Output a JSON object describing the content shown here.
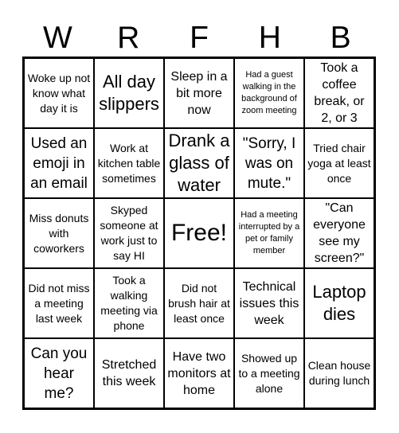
{
  "header": {
    "letters": [
      "W",
      "R",
      "F",
      "H",
      "B"
    ]
  },
  "board": {
    "rows": [
      [
        {
          "text": "Woke up not know what day it is",
          "size": "fs-s"
        },
        {
          "text": "All day slippers",
          "size": "fs-xl"
        },
        {
          "text": "Sleep in a bit more now",
          "size": "fs-m"
        },
        {
          "text": "Had a guest walking in the background of zoom meeting",
          "size": "fs-xs"
        },
        {
          "text": "Took a coffee break, or 2, or 3",
          "size": "fs-m"
        }
      ],
      [
        {
          "text": "Used an emoji in an email",
          "size": "fs-l"
        },
        {
          "text": "Work at kitchen table sometimes",
          "size": "fs-s"
        },
        {
          "text": "Drank a glass of water",
          "size": "fs-xl"
        },
        {
          "text": "\"Sorry, I was on mute.\"",
          "size": "fs-l"
        },
        {
          "text": "Tried chair yoga at least once",
          "size": "fs-s"
        }
      ],
      [
        {
          "text": "Miss donuts with coworkers",
          "size": "fs-s"
        },
        {
          "text": "Skyped someone at work just to say HI",
          "size": "fs-s"
        },
        {
          "text": "Free!",
          "size": "fs-xxl"
        },
        {
          "text": "Had a meeting interrupted by a pet or family member",
          "size": "fs-xs"
        },
        {
          "text": "\"Can everyone see my screen?\"",
          "size": "fs-m"
        }
      ],
      [
        {
          "text": "Did not miss a meeting last week",
          "size": "fs-s"
        },
        {
          "text": "Took a walking meeting via phone",
          "size": "fs-s"
        },
        {
          "text": "Did not brush hair at least once",
          "size": "fs-s"
        },
        {
          "text": "Technical issues this week",
          "size": "fs-m"
        },
        {
          "text": "Laptop dies",
          "size": "fs-xl"
        }
      ],
      [
        {
          "text": "Can you hear me?",
          "size": "fs-l"
        },
        {
          "text": "Stretched this week",
          "size": "fs-m"
        },
        {
          "text": "Have two monitors at home",
          "size": "fs-m"
        },
        {
          "text": "Showed up to a meeting alone",
          "size": "fs-s"
        },
        {
          "text": "Clean house during lunch",
          "size": "fs-s"
        }
      ]
    ]
  }
}
